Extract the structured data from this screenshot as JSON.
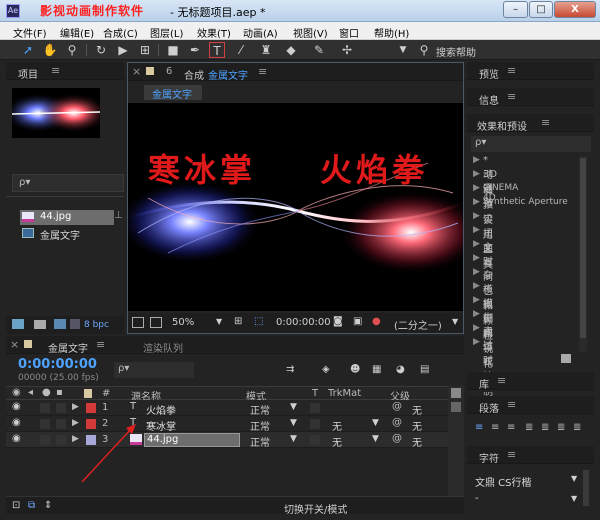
{
  "window": {
    "watermark": "影视动画制作软件",
    "title": "- 无标题项目.aep *",
    "minimize": "–",
    "maximize": "□",
    "close": "X"
  },
  "menu": [
    "文件(F)",
    "编辑(E)",
    "合成(C)",
    "图层(L)",
    "效果(T)",
    "动画(A)",
    "视图(V)",
    "窗口",
    "帮助(H)"
  ],
  "toolbar": {
    "search_help": "搜索帮助"
  },
  "project": {
    "tab": "项目",
    "search_placeholder": "ρ▾",
    "items": [
      {
        "name": "44.jpg",
        "selected": true
      },
      {
        "name": "金属文字",
        "selected": false
      }
    ],
    "bpc": "8 bpc"
  },
  "composition": {
    "tab_prefix": "合成",
    "tab_name": "金属文字",
    "subtab": "金属文字",
    "preview_text_left": "寒冰掌",
    "preview_text_right": "火焰拳",
    "zoom": "50%",
    "timecode": "0:00:00:00",
    "resolution": "(二分之一)"
  },
  "right_panels": {
    "preview": "预览",
    "info": "信息",
    "effects_title": "效果和预设",
    "effects_search": "ρ▾",
    "effects": [
      "* 动画预设",
      "3D 通道",
      "CINEMA 4D",
      "Synthetic Aperture",
      "实用工具",
      "扭曲",
      "文本",
      "时间",
      "杂色和颗粒",
      "模拟",
      "模糊和锐化",
      "生成",
      "表达式控制",
      "过时"
    ],
    "library": "库",
    "paragraph": "段落",
    "character": "字符",
    "font_name": "文鼎 CS行楷",
    "font_style": "-"
  },
  "timeline": {
    "tab": "金属文字",
    "render_queue": "渲染队列",
    "timecode": "0:00:00:00",
    "frame_info": "00000 (25.00 fps)",
    "columns": {
      "num": "#",
      "source": "源名称",
      "mode": "模式",
      "t": "T",
      "trkmat": "TrkMat",
      "parent": "父级"
    },
    "layers": [
      {
        "num": "1",
        "name": "火焰拳",
        "mode": "正常",
        "trkmat": "",
        "parent": "无",
        "color": "#d23a3a"
      },
      {
        "num": "2",
        "name": "寒冰掌",
        "mode": "正常",
        "trkmat": "无",
        "parent": "无",
        "color": "#d23a3a"
      },
      {
        "num": "3",
        "name": "44.jpg",
        "mode": "正常",
        "trkmat": "无",
        "parent": "无",
        "color": "#a8a8d8"
      }
    ],
    "footer": "切换开关/模式"
  }
}
